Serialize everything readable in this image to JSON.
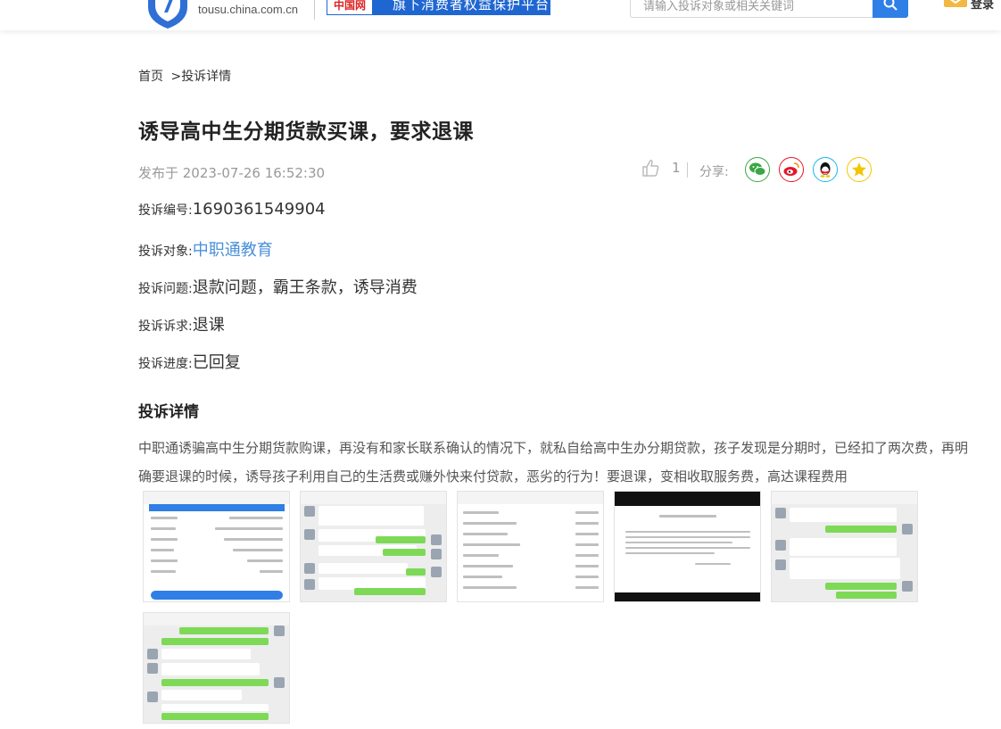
{
  "header": {
    "logo_url": "tousu.china.com.cn",
    "partner_badge": "中国网",
    "partner_text": "旗下消费者权益保护平台",
    "search_placeholder": "请输入投诉对象或相关关键词",
    "login_text": "登录"
  },
  "breadcrumb": {
    "home": "首页",
    "sep": ">",
    "current": "投诉详情"
  },
  "complaint": {
    "title": "诱导高中生分期货款买课，要求退课",
    "published": "发布于 2023-07-26 16:52:30",
    "likes": "1",
    "share_label": "分享:",
    "fields": [
      {
        "label": "投诉编号:",
        "value": "1690361549904"
      },
      {
        "label": "投诉对象:",
        "value": "中职通教育"
      },
      {
        "label": "投诉问题:",
        "value": "退款问题，霸王条款，诱导消费"
      },
      {
        "label": "投诉诉求:",
        "value": "退课"
      },
      {
        "label": "投诉进度:",
        "value": "已回复"
      }
    ],
    "detail_title": "投诉详情",
    "detail_text": "中职通诱骗高中生分期货款购课，再没有和家长联系确认的情况下，就私自给高中生办分期贷款，孩子发现是分期时，已经扣了两次费，再明确要退课的时候，诱导孩子利用自己的生活费或赚外快来付贷款，恶劣的行为！要退课，变相收取服务费，高达课程费用"
  },
  "share_icons": [
    "wechat-icon",
    "weibo-icon",
    "qq-icon",
    "qzone-icon"
  ],
  "colors": {
    "accent": "#2f7fe6",
    "link": "#4a90d9",
    "wechat": "#3aa744",
    "weibo": "#e6162d",
    "qq": "#12b7f5",
    "qzone": "#f5c400"
  }
}
